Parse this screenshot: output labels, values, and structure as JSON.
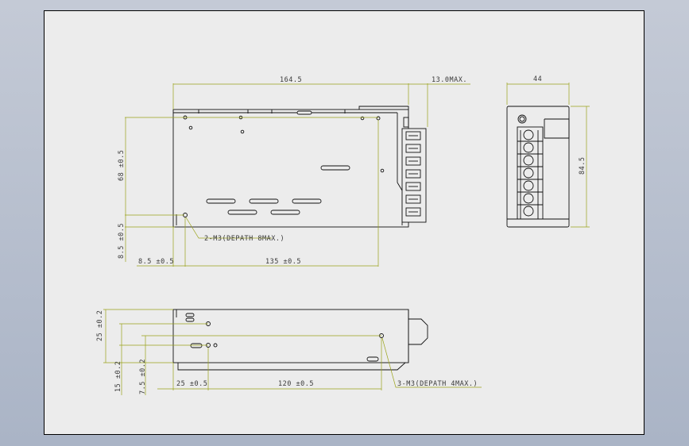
{
  "drawing": {
    "top_view": {
      "overall_length": "164.5",
      "terminal_protrusion": "13.0MAX.",
      "height_dim": "68 ±0.5",
      "bottom_offset": "8.5 ±0.5",
      "left_offset": "8.5 ±0.5",
      "hole_spacing": "135 ±0.5",
      "mount_note": "2-M3(DEPATH 8MAX.)"
    },
    "end_view": {
      "width": "44",
      "height": "84.5"
    },
    "side_view": {
      "height_dim": "25 ±0.2",
      "hole_height_a": "15 ±0.2",
      "hole_height_b": "7.5 ±0.2",
      "left_offset": "25 ±0.5",
      "hole_spacing": "120 ±0.5",
      "mount_note": "3-M3(DEPATH 4MAX.)"
    }
  },
  "colors": {
    "background": "#aab4c6",
    "sheet": "#ececec",
    "outline": "#111111",
    "dimension_line": "#9aa31a",
    "dimension_text": "#3a3a3a"
  }
}
